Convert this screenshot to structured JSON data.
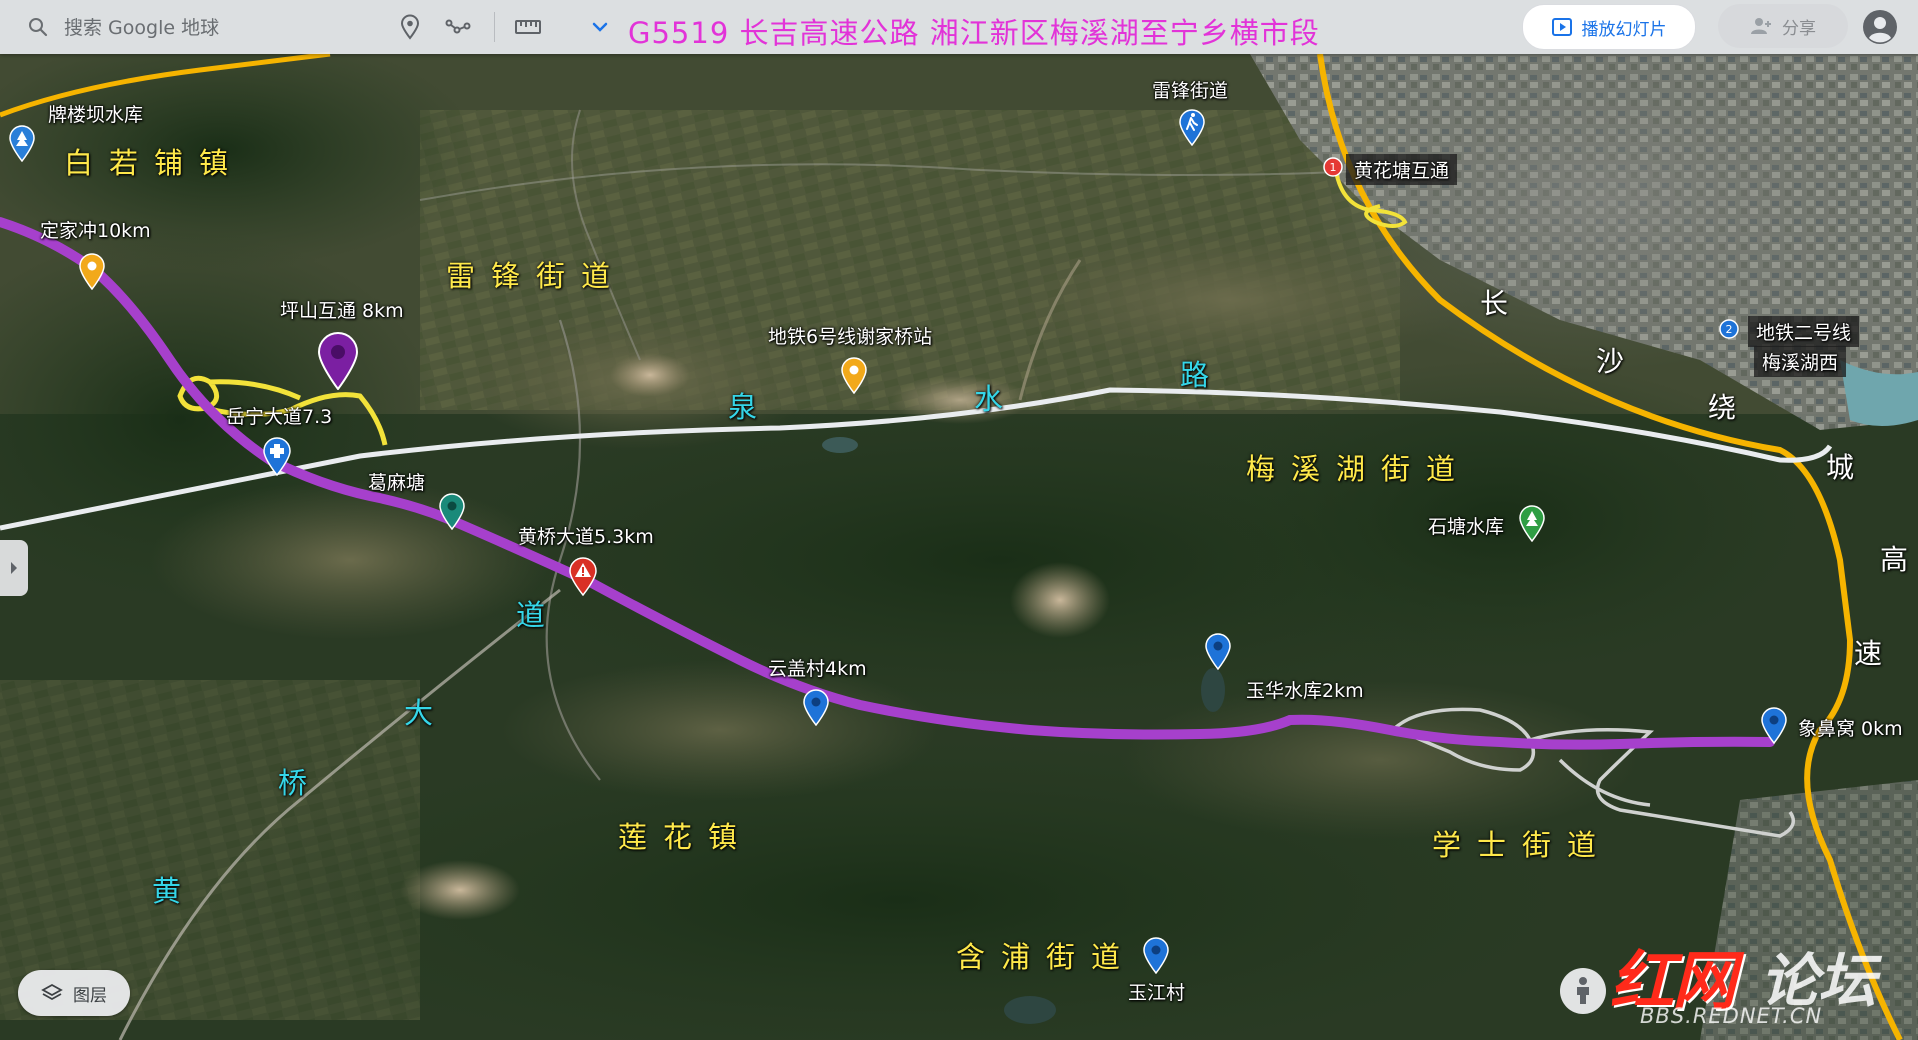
{
  "toolbar": {
    "search_placeholder": "搜索 Google 地球",
    "slideshow_label": "播放幻灯片",
    "share_label": "分享"
  },
  "map_title": "G5519  长吉高速公路  湘江新区梅溪湖至宁乡横市段",
  "layers_label": "图层",
  "watermark": {
    "logo": "红网",
    "forum": "论坛",
    "url": "BBS.REDNET.CN"
  },
  "colors": {
    "route": "#a640cc",
    "yellow_route": "#f2e23a",
    "ring_road": "#f6b400",
    "quanshui_road": "#e9ecef",
    "title": "#e233d8",
    "district_label": "#ffe94a",
    "road_label": "#35d6e8"
  },
  "districts": [
    {
      "name": "白若铺镇"
    },
    {
      "name": "雷锋街道"
    },
    {
      "name": "梅溪湖街道"
    },
    {
      "name": "莲花镇"
    },
    {
      "name": "学士街道"
    },
    {
      "name": "含浦街道"
    }
  ],
  "road_chars": {
    "quanshui": [
      "泉",
      "水",
      "路"
    ],
    "huangqiao": [
      "道",
      "大",
      "桥",
      "黄"
    ],
    "ring": [
      "长",
      "沙",
      "绕",
      "城",
      "高",
      "速"
    ]
  },
  "pois": [
    {
      "name": "牌楼坝水库",
      "icon": "park-icon"
    },
    {
      "name": "定家冲10km",
      "icon": "marker-orange-icon"
    },
    {
      "name": "坪山互通 8km",
      "icon": "marker-purple-large-icon"
    },
    {
      "name": "岳宁大道7.3",
      "icon": "none"
    },
    {
      "name": "葛麻塘",
      "icon": "marker-teal-icon"
    },
    {
      "name": "黄桥大道5.3km",
      "icon": "warning-marker-icon"
    },
    {
      "name": "地铁6号线谢家桥站",
      "icon": "marker-orange-icon"
    },
    {
      "name": "雷锋街道",
      "icon": "hiking-icon"
    },
    {
      "name": "黄花塘互通",
      "icon": "numbered-marker-icon",
      "number": "1"
    },
    {
      "name": "地铁二号线",
      "icon": "numbered-marker-icon",
      "number": "2"
    },
    {
      "name": "梅溪湖西",
      "icon": "none"
    },
    {
      "name": "石塘水库",
      "icon": "park-icon"
    },
    {
      "name": "云盖村4km",
      "icon": "marker-blue-icon"
    },
    {
      "name": "玉华水库2km",
      "icon": "marker-blue-icon"
    },
    {
      "name": "象鼻窝  0km",
      "icon": "marker-blue-icon"
    },
    {
      "name": "玉江村",
      "icon": "marker-blue-icon"
    },
    {
      "name": "",
      "icon": "medical-marker-icon"
    }
  ]
}
